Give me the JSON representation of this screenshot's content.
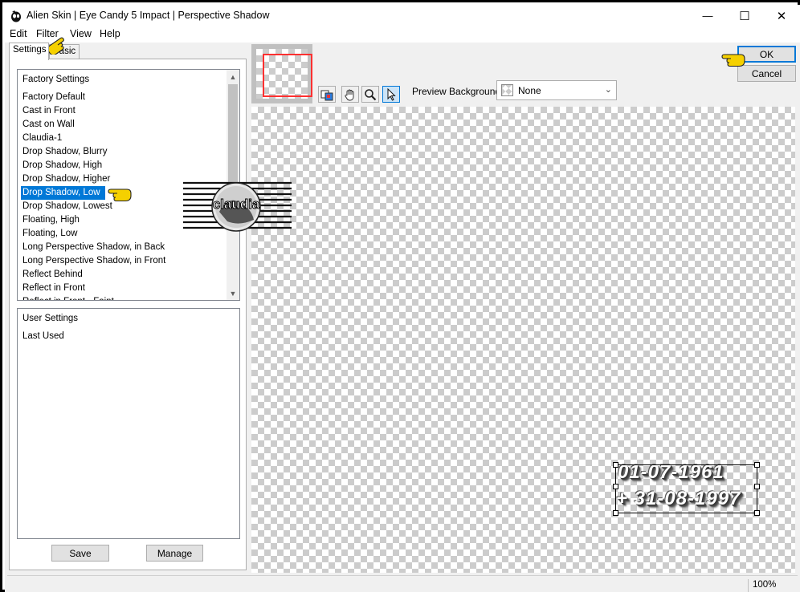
{
  "window": {
    "title": "Alien Skin | Eye Candy 5 Impact | Perspective Shadow",
    "minimize_glyph": "—",
    "maximize_glyph": "☐",
    "close_glyph": "✕"
  },
  "menu": {
    "items": [
      "Edit",
      "Filter",
      "View",
      "Help"
    ]
  },
  "tabs": [
    {
      "label": "Settings",
      "active": true
    },
    {
      "label": "Basic",
      "active": false
    }
  ],
  "factory_settings": {
    "header": "Factory Settings",
    "items": [
      "Factory Default",
      "Cast in Front",
      "Cast on Wall",
      "Claudia-1",
      "Drop Shadow, Blurry",
      "Drop Shadow, High",
      "Drop Shadow, Higher",
      "Drop Shadow, Low",
      "Drop Shadow, Lowest",
      "Floating, High",
      "Floating, Low",
      "Long Perspective Shadow, in Back",
      "Long Perspective Shadow, in Front",
      "Reflect Behind",
      "Reflect in Front",
      "Reflect in Front - Faint"
    ],
    "selected_index": 7
  },
  "user_settings": {
    "header": "User Settings",
    "items": [
      "Last Used"
    ]
  },
  "buttons": {
    "save": "Save",
    "manage": "Manage",
    "ok": "OK",
    "cancel": "Cancel"
  },
  "preview": {
    "background_label": "Preview Background:",
    "background_value": "None",
    "text_line1": "01-07-1961",
    "text_line2": "+ 31-08-1997"
  },
  "watermark": {
    "text": "claudia"
  },
  "status": {
    "zoom": "100%"
  },
  "colors": {
    "selection": "#0078d7",
    "thumbnail_frame": "#ff3030",
    "pointer_hand": "#f5d000"
  },
  "icons": [
    "app-logo-icon",
    "preview-compare-icon",
    "hand-pan-icon",
    "zoom-icon",
    "arrow-select-icon",
    "pointing-hand-icon",
    "chevron-down-icon"
  ]
}
